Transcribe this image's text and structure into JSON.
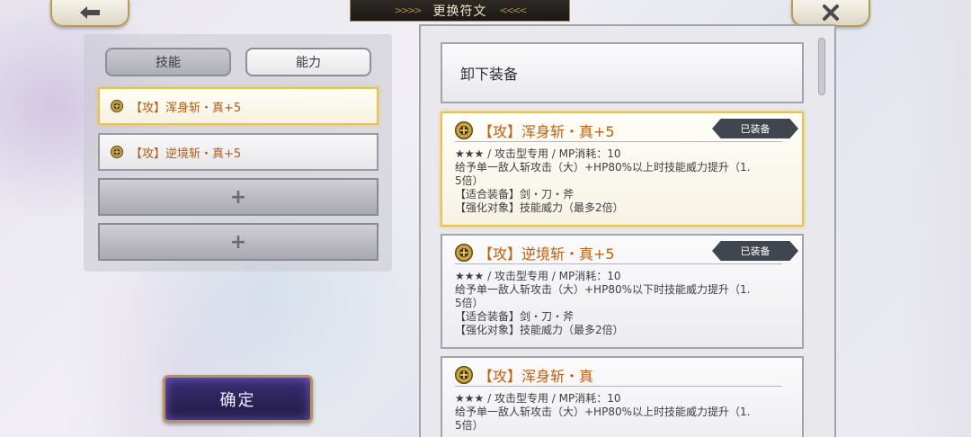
{
  "header": {
    "title": "更换符文",
    "back_icon": "arrow-left-icon",
    "close_icon": "close-icon"
  },
  "left": {
    "tabs": [
      {
        "label": "技能"
      },
      {
        "label": "能力"
      }
    ],
    "slots": [
      {
        "label": "【攻】浑身斩・真+5",
        "selected": true
      },
      {
        "label": "【攻】逆境斩・真+5",
        "selected": false
      }
    ],
    "empty_slot_symbol": "+",
    "confirm_label": "确定"
  },
  "right": {
    "unequip_label": "卸下装备",
    "cards": [
      {
        "title": "【攻】浑身斩・真+5",
        "badge": "已装备",
        "stats": "★★★ / 攻击型专用 / MP消耗：10",
        "desc1": "给予单一敌人斩攻击（大）+HP80%以上时技能威力提升（1.",
        "desc2": "5倍）",
        "equip": "【适合装备】剑・刀・斧",
        "target": "【强化对象】技能威力（最多2倍）"
      },
      {
        "title": "【攻】逆境斩・真+5",
        "badge": "已装备",
        "stats": "★★★ / 攻击型专用 / MP消耗：10",
        "desc1": "给予单一敌人斩攻击（大）+HP80%以下时技能威力提升（1.",
        "desc2": "5倍）",
        "equip": "【适合装备】剑・刀・斧",
        "target": "【强化对象】技能威力（最多2倍）"
      },
      {
        "title": "【攻】浑身斩・真",
        "stats": "★★★ / 攻击型专用 / MP消耗：10",
        "desc1": "给予单一敌人斩攻击（大）+HP80%以上时技能威力提升（1.",
        "desc2": "5倍）"
      }
    ]
  },
  "colors": {
    "accent_gold": "#e8c24a",
    "rune_title": "#c0600f",
    "badge_bg": "#3f4650",
    "confirm_bg": "#2b2360"
  }
}
